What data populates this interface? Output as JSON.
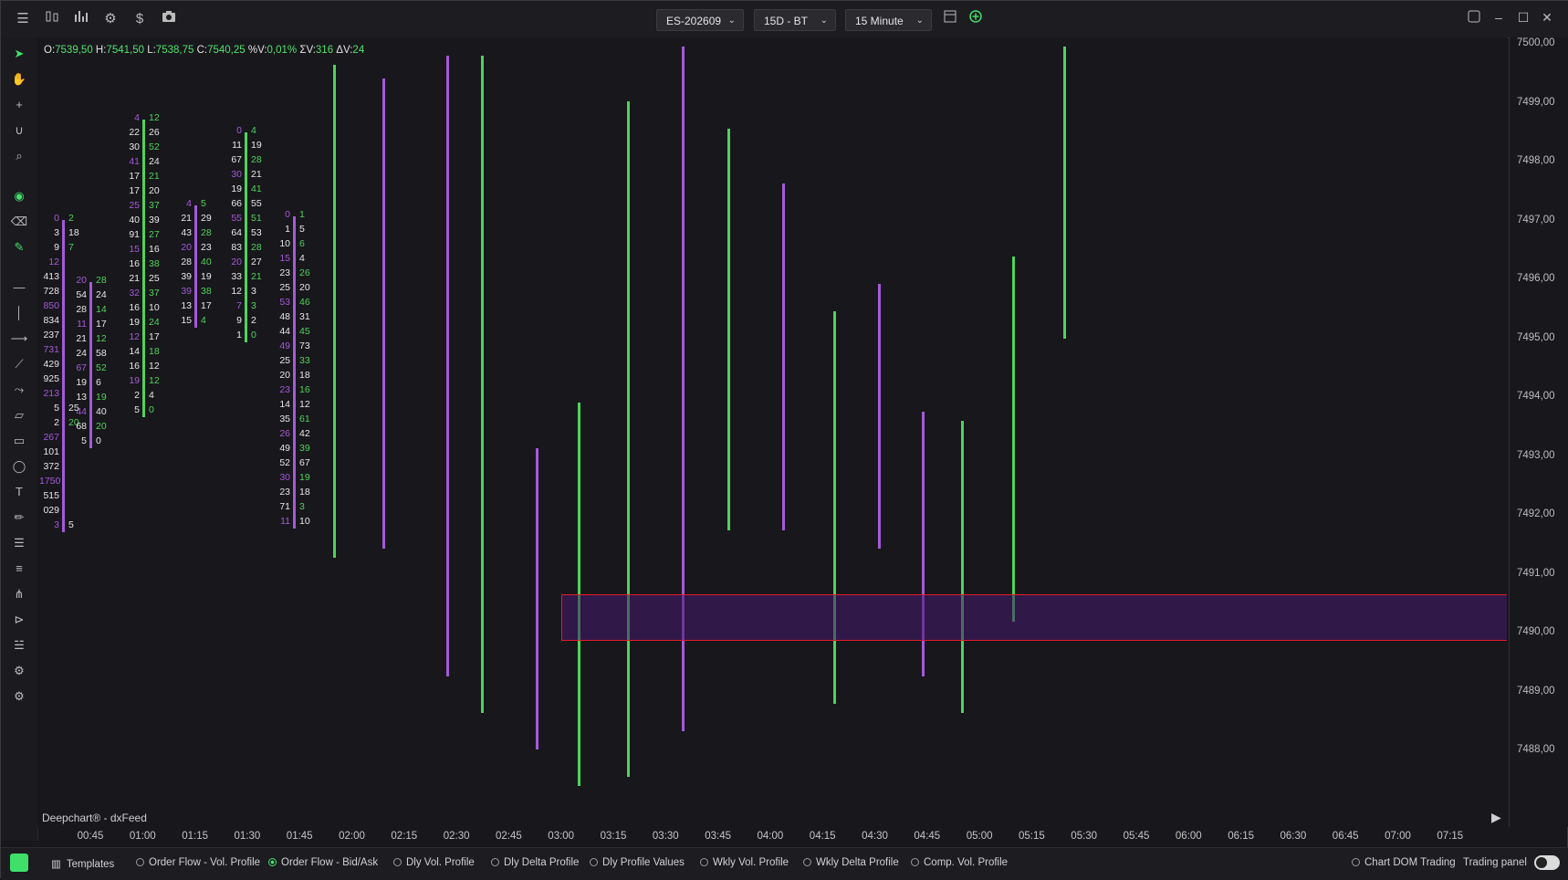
{
  "toolbar": {
    "icons": [
      "menu-icon",
      "bars-icon",
      "bar-chart-icon",
      "settings-icon",
      "dollar-icon",
      "camera-icon"
    ],
    "symbol": "ES-202609",
    "period": "15D - BT",
    "interval": "15 Minute",
    "extra_icons": [
      "layout-icon",
      "add-circle-icon"
    ],
    "window_icons": [
      "panel-icon",
      "minimize-icon",
      "maximize-icon",
      "close-icon"
    ]
  },
  "ohlc": {
    "o_label": "O:",
    "o": "7539,50",
    "h_label": "H:",
    "h": "7541,50",
    "l_label": "L:",
    "l": "7538,75",
    "c_label": "C:",
    "c": "7540,25",
    "pv_label": "%V:",
    "pv": "0,01%",
    "sv_label": "ΣV:",
    "sv": "316",
    "dv_label": "ΔV:",
    "dv": "24"
  },
  "price_axis": [
    "7500,00",
    "7499,00",
    "7498,00",
    "7497,00",
    "7496,00",
    "7495,00",
    "7494,00",
    "7493,00",
    "7492,00",
    "7491,00",
    "7490,00",
    "7489,00",
    "7488,00"
  ],
  "time_axis": [
    "00:45",
    "01:00",
    "01:15",
    "01:30",
    "01:45",
    "02:00",
    "02:15",
    "02:30",
    "02:45",
    "03:00",
    "03:15",
    "03:30",
    "03:45",
    "04:00",
    "04:15",
    "04:30",
    "04:45",
    "05:00",
    "05:15",
    "05:30",
    "05:45",
    "06:00",
    "06:15",
    "06:30",
    "06:45",
    "07:00",
    "07:15"
  ],
  "watermark": "Deepchart® - dxFeed",
  "bottom": {
    "templates": "Templates",
    "options": [
      {
        "label": "Order Flow - Vol. Profile",
        "on": false
      },
      {
        "label": "Order Flow - Bid/Ask",
        "on": true
      },
      {
        "label": "Dly Vol. Profile",
        "on": false
      },
      {
        "label": "Dly Delta Profile",
        "on": false
      },
      {
        "label": "Dly Profile Values",
        "on": false
      },
      {
        "label": "Wkly Vol. Profile",
        "on": false
      },
      {
        "label": "Wkly Delta Profile",
        "on": false
      },
      {
        "label": "Comp. Vol. Profile",
        "on": false
      }
    ],
    "chart_dom": "Chart DOM Trading",
    "trading_panel": "Trading panel"
  },
  "colors": {
    "bid_purple": "#a45ad8",
    "ask_green": "#4fd35a",
    "neutral": "#e8e8e8",
    "highlight": "#e5e04a",
    "zone_border": "#e11d2a"
  },
  "footprint": [
    {
      "bar": "purple",
      "rows": [
        [
          "0",
          "2"
        ],
        [
          "3",
          "18"
        ],
        [
          "9",
          "7"
        ],
        [
          "12",
          ""
        ],
        [
          "413",
          ""
        ],
        [
          "728",
          ""
        ],
        [
          "850",
          ""
        ],
        [
          "834",
          ""
        ],
        [
          "237",
          ""
        ],
        [
          "731",
          ""
        ],
        [
          "429",
          ""
        ],
        [
          "925",
          ""
        ],
        [
          "213",
          ""
        ],
        [
          "5",
          "25"
        ],
        [
          "2",
          "20"
        ],
        [
          "267",
          ""
        ],
        [
          "101",
          ""
        ],
        [
          "372",
          ""
        ],
        [
          "1750",
          ""
        ],
        [
          "515",
          ""
        ],
        [
          "029",
          ""
        ],
        [
          "3",
          "5"
        ]
      ]
    },
    {
      "bar": "purple",
      "rows": [
        [
          "20",
          "28"
        ],
        [
          "54",
          "24"
        ],
        [
          "28",
          "14"
        ],
        [
          "11",
          "17"
        ],
        [
          "21",
          "12"
        ],
        [
          "24",
          "58"
        ],
        [
          "67",
          "52"
        ],
        [
          "19",
          "6"
        ],
        [
          "13",
          "19"
        ],
        [
          "44",
          "40"
        ],
        [
          "68",
          "20"
        ],
        [
          "5",
          "0"
        ]
      ]
    },
    {
      "bar": "green",
      "rows": [
        [
          "4",
          "12"
        ],
        [
          "22",
          "26"
        ],
        [
          "30",
          "52"
        ],
        [
          "41",
          "24"
        ],
        [
          "17",
          "21"
        ],
        [
          "17",
          "20"
        ],
        [
          "25",
          "37"
        ],
        [
          "40",
          "39"
        ],
        [
          "91",
          "27"
        ],
        [
          "15",
          "16"
        ],
        [
          "16",
          "38"
        ],
        [
          "21",
          "25"
        ],
        [
          "32",
          "37"
        ],
        [
          "16",
          "10"
        ],
        [
          "19",
          "24"
        ],
        [
          "12",
          "17"
        ],
        [
          "14",
          "18"
        ],
        [
          "16",
          "12"
        ],
        [
          "19",
          "12"
        ],
        [
          "2",
          "4"
        ],
        [
          "5",
          "0"
        ]
      ]
    },
    {
      "bar": "purple",
      "rows": [
        [
          "4",
          "5"
        ],
        [
          "21",
          "29"
        ],
        [
          "43",
          "28"
        ],
        [
          "20",
          "23"
        ],
        [
          "28",
          "40"
        ],
        [
          "39",
          "19"
        ],
        [
          "39",
          "38"
        ],
        [
          "13",
          "17"
        ],
        [
          "15",
          "4"
        ]
      ]
    },
    {
      "bar": "green",
      "rows": [
        [
          "0",
          "4"
        ],
        [
          "11",
          "19"
        ],
        [
          "67",
          "28"
        ],
        [
          "30",
          "21"
        ],
        [
          "19",
          "41"
        ],
        [
          "66",
          "55"
        ],
        [
          "55",
          "51"
        ],
        [
          "64",
          "53"
        ],
        [
          "83",
          "28"
        ],
        [
          "20",
          "27"
        ],
        [
          "33",
          "21"
        ],
        [
          "12",
          "3"
        ],
        [
          "7",
          "3"
        ],
        [
          "9",
          "2"
        ],
        [
          "1",
          "0"
        ]
      ]
    },
    {
      "bar": "purple",
      "rows": [
        [
          "0",
          "1"
        ],
        [
          "1",
          "5"
        ],
        [
          "10",
          "6"
        ],
        [
          "15",
          "4"
        ],
        [
          "23",
          "26"
        ],
        [
          "25",
          "20"
        ],
        [
          "53",
          "46"
        ],
        [
          "48",
          "31"
        ],
        [
          "44",
          "45"
        ],
        [
          "49",
          "73"
        ],
        [
          "25",
          "33"
        ],
        [
          "20",
          "18"
        ],
        [
          "23",
          "16"
        ],
        [
          "14",
          "12"
        ],
        [
          "35",
          "61"
        ],
        [
          "26",
          "42"
        ],
        [
          "49",
          "39"
        ],
        [
          "52",
          "67"
        ],
        [
          "30",
          "19"
        ],
        [
          "23",
          "18"
        ],
        [
          "71",
          "3"
        ],
        [
          "11",
          "10"
        ]
      ]
    }
  ]
}
